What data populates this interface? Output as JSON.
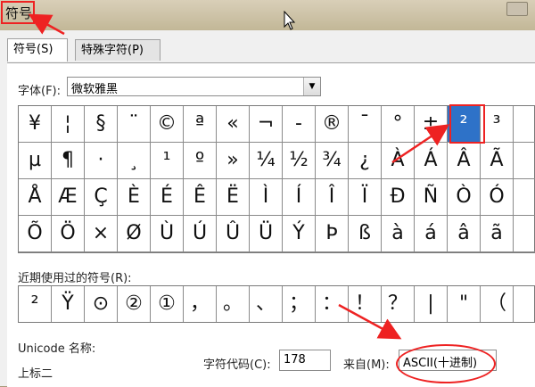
{
  "title": "符号",
  "tabs": [
    {
      "label": "符号(S)",
      "active": true
    },
    {
      "label": "特殊字符(P)",
      "active": false
    }
  ],
  "font": {
    "label": "字体(F):",
    "value": "微软雅黑"
  },
  "grid_rows": [
    [
      "¥",
      "¦",
      "§",
      "¨",
      "©",
      "ª",
      "«",
      "¬",
      "-",
      "®",
      "¯",
      "°",
      "±",
      "²",
      "³",
      ""
    ],
    [
      "µ",
      "¶",
      "·",
      "¸",
      "¹",
      "º",
      "»",
      "¼",
      "½",
      "¾",
      "¿",
      "À",
      "Á",
      "Â",
      "Ã",
      ""
    ],
    [
      "Å",
      "Æ",
      "Ç",
      "È",
      "É",
      "Ê",
      "Ë",
      "Ì",
      "Í",
      "Î",
      "Ï",
      "Ð",
      "Ñ",
      "Ò",
      "Ó",
      ""
    ],
    [
      "Õ",
      "Ö",
      "×",
      "Ø",
      "Ù",
      "Ú",
      "Û",
      "Ü",
      "Ý",
      "Þ",
      "ß",
      "à",
      "á",
      "â",
      "ã",
      ""
    ]
  ],
  "selected": {
    "row": 0,
    "col": 13
  },
  "recent": {
    "label": "近期使用过的符号(R):",
    "items": [
      "²",
      "Ÿ",
      "⊙",
      "②",
      "①",
      "，",
      "。",
      "、",
      "；",
      "：",
      "！",
      "？",
      "|",
      "\"",
      "（",
      ""
    ]
  },
  "unicode": {
    "label": "Unicode 名称:",
    "name": "上标二"
  },
  "char_code": {
    "label": "字符代码(C):",
    "value": "178"
  },
  "from": {
    "label": "来自(M):",
    "value": "ASCII(十进制)"
  },
  "colors": {
    "annotation": "#e22222",
    "selection": "#2e72c8"
  }
}
